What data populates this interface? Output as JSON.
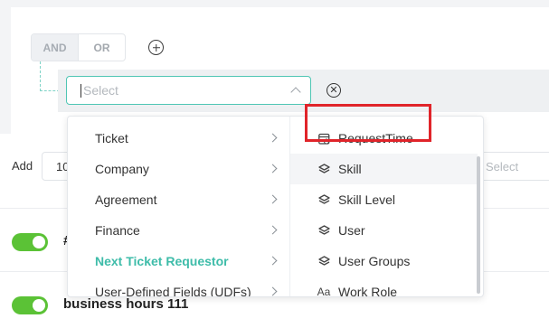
{
  "logic": {
    "and_label": "AND",
    "or_label": "OR"
  },
  "condition": {
    "placeholder": "Select"
  },
  "add_row": {
    "label": "Add",
    "value": "10",
    "right_placeholder": "Select"
  },
  "dropdown": {
    "categories": [
      {
        "label": "Ticket"
      },
      {
        "label": "Company"
      },
      {
        "label": "Agreement"
      },
      {
        "label": "Finance"
      },
      {
        "label": "Next Ticket Requestor",
        "active": true
      },
      {
        "label": "User-Defined Fields (UDFs)"
      }
    ],
    "fields": [
      {
        "label": "RequestTime",
        "icon": "calendar-clock-icon"
      },
      {
        "label": "Skill",
        "icon": "layers-icon"
      },
      {
        "label": "Skill Level",
        "icon": "layers-icon"
      },
      {
        "label": "User",
        "icon": "layers-icon"
      },
      {
        "label": "User Groups",
        "icon": "layers-icon"
      },
      {
        "label": "Work Role",
        "icon": "text-type-icon",
        "glyph": "Aa"
      }
    ]
  },
  "rules": [
    {
      "label": "#",
      "enabled": true
    },
    {
      "label": "business hours 111",
      "enabled": true
    }
  ],
  "colors": {
    "accent": "#3ebca9",
    "toggle_on": "#5bc236",
    "highlight": "#e0242a"
  }
}
